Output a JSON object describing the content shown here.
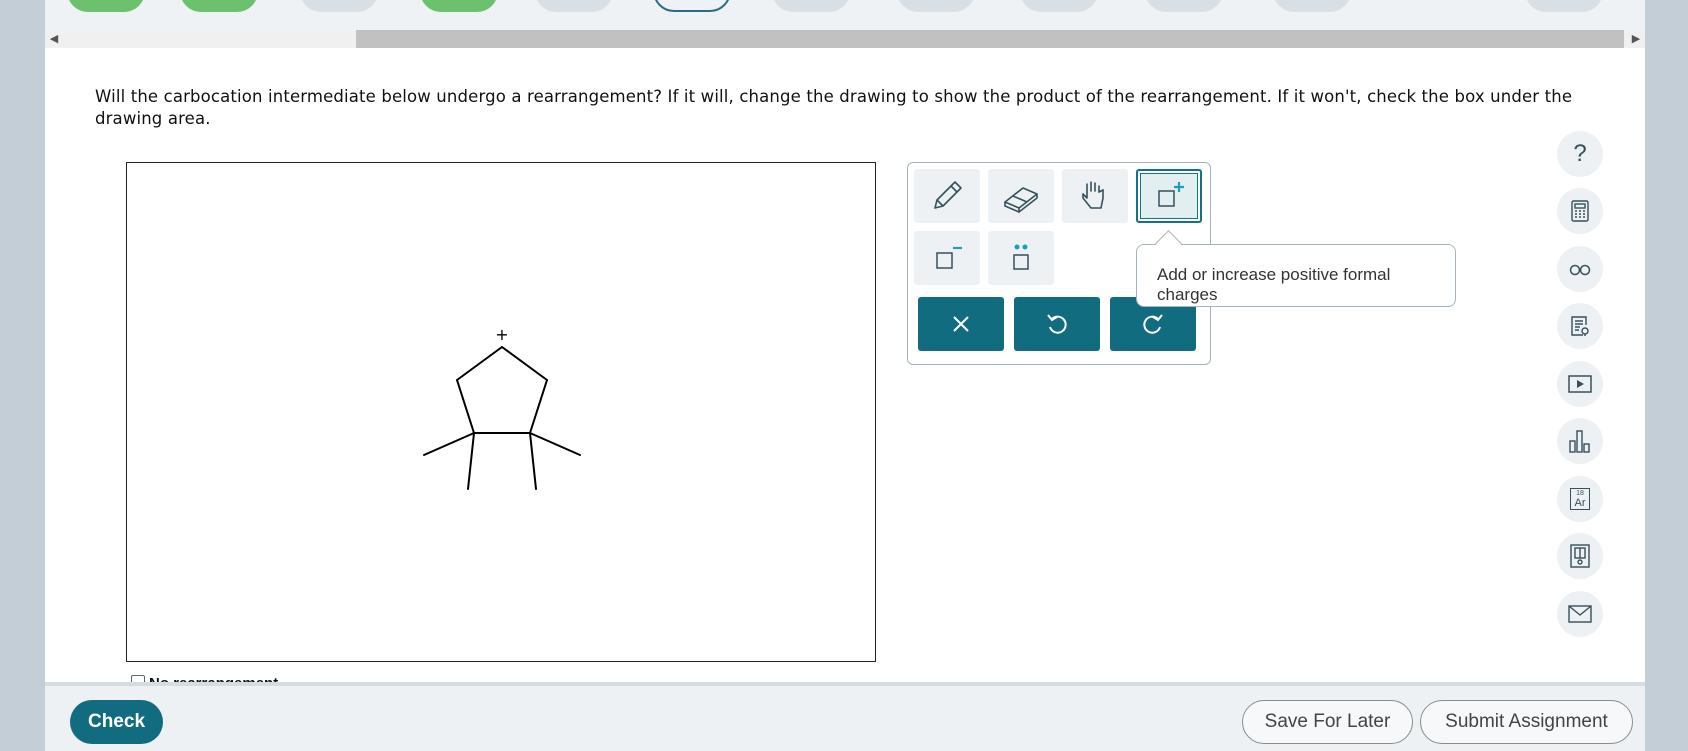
{
  "question": {
    "text": "Will the carbocation intermediate below undergo a rearrangement? If it will, change the drawing to show the product of the rearrangement. If it won't, check the box under the drawing area."
  },
  "drawing": {
    "charge_label": "+",
    "checkbox_label": "No rearrangement"
  },
  "toolbox": {
    "tools": [
      {
        "name": "pencil-icon",
        "active": false
      },
      {
        "name": "eraser-icon",
        "active": false
      },
      {
        "name": "hand-icon",
        "active": false
      },
      {
        "name": "positive-charge-icon",
        "active": true
      },
      {
        "name": "negative-charge-icon",
        "active": false
      },
      {
        "name": "lone-pair-icon",
        "active": false
      }
    ],
    "actions": [
      {
        "name": "clear-icon"
      },
      {
        "name": "undo-icon"
      },
      {
        "name": "redo-icon"
      }
    ],
    "accent": "#126c80"
  },
  "tooltip": {
    "text": "Add or increase positive formal charges"
  },
  "sidebar": {
    "help_label": "?",
    "icons": [
      "help-icon",
      "calculator-icon",
      "glasses-icon",
      "reference-icon",
      "video-icon",
      "chart-icon",
      "periodic-table-icon",
      "ebook-icon",
      "mail-icon"
    ],
    "periodic_number": "18",
    "periodic_symbol": "Ar"
  },
  "footer": {
    "check_label": "Check",
    "save_label": "Save For Later",
    "submit_label": "Submit Assignment"
  },
  "progress": {
    "statuses": [
      "green",
      "green",
      "gray",
      "green",
      "gray",
      "current",
      "gray",
      "gray",
      "gray",
      "gray",
      "gray",
      "gray"
    ]
  }
}
